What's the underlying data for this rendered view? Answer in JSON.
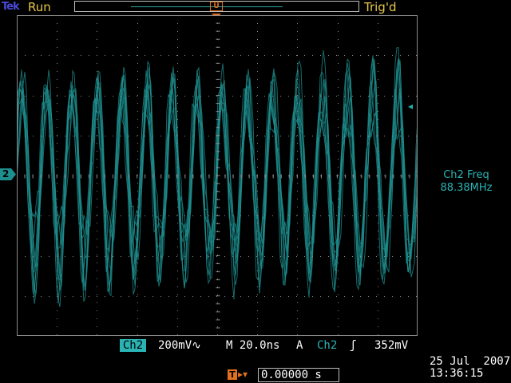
{
  "topbar": {
    "logo": "Tek",
    "acq_state": "Run",
    "trigger_state": "Trig'd",
    "record_trigger_marker": "U"
  },
  "screen": {
    "ch2_marker": "2",
    "trigger_marker": "T",
    "trace_color": "#1f8f8f",
    "grid_color": "#8a8a8a"
  },
  "measurement": {
    "label": "Ch2 Freq",
    "value": "88.38MHz"
  },
  "status": {
    "channel": "Ch2",
    "scale": "200mV",
    "coupling_icon": "ac-coupling-icon",
    "coupling_symbol": "∿",
    "timebase": "M 20.0ns",
    "trigger_mode": "A",
    "trigger_source": "Ch2",
    "trigger_slope_symbol": "ʃ",
    "trigger_level": "352mV"
  },
  "bottom": {
    "trigger_position_marker": "T",
    "trigger_position_arrow": "▸▾",
    "delay": "0.00000 s",
    "date": "25 Jul  2007",
    "time": "13:36:15"
  }
}
